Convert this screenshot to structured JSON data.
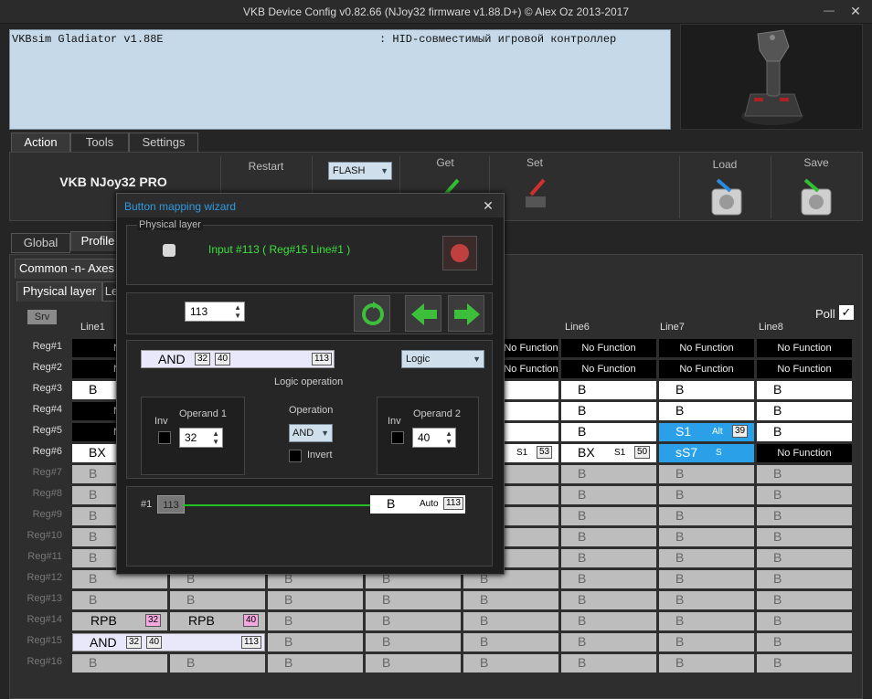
{
  "window": {
    "title": "VKB Device Config v0.82.66 (NJoy32 firmware v1.88.D+) © Alex Oz 2013-2017",
    "minimize": "—",
    "close": "✕"
  },
  "info": {
    "device": "VKBsim Gladiator  v1.88E",
    "desc": ": HID-совместимый игровой контроллер"
  },
  "main_tabs": [
    "Action",
    "Tools",
    "Settings"
  ],
  "toolbar": {
    "device_label": "VKB NJoy32 PRO",
    "restart": "Restart",
    "flash": "FLASH",
    "get": "Get",
    "set": "Set",
    "load": "Load",
    "save": "Save"
  },
  "sub_tabs": [
    "Global",
    "Profile"
  ],
  "subsub_tab": "Common -n- Axes",
  "layer_tabs": [
    "Physical layer",
    "Le"
  ],
  "srv": "Srv",
  "poll": {
    "label": "Poll",
    "check": "✓"
  },
  "columns": [
    "Line1",
    "Line6",
    "Line7",
    "Line8"
  ],
  "rows": [
    "Reg#1",
    "Reg#2",
    "Reg#3",
    "Reg#4",
    "Reg#5",
    "Reg#6",
    "Reg#7",
    "Reg#8",
    "Reg#9",
    "Reg#10",
    "Reg#11",
    "Reg#12",
    "Reg#13",
    "Reg#14",
    "Reg#15",
    "Reg#16"
  ],
  "cells": {
    "nf": "No Function",
    "nf_short": "No",
    "b": "B",
    "bx": "BX",
    "s1": "S1",
    "alt": "Alt",
    "n39": "39",
    "n53": "53",
    "n50": "50",
    "ss7": "sS7",
    "s": "S",
    "rpb": "RPB",
    "n32": "32",
    "n40": "40",
    "and": "AND",
    "n113": "113"
  },
  "dialog": {
    "title": "Button mapping wizard",
    "close": "✕",
    "physical_layer": "Physical layer",
    "input_text": "Input #113 ( Reg#15  Line#1 )",
    "spin_value": "113",
    "logic_expr": {
      "op": "AND",
      "a": "32",
      "b": "40",
      "num": "113"
    },
    "logic_select": "Logic",
    "logic_caption": "Logic operation",
    "inv": "Inv",
    "operand1": "Operand 1",
    "operand1_value": "32",
    "operation": "Operation",
    "operation_value": "AND",
    "invert": "Invert",
    "operand2": "Operand 2",
    "operand2_value": "40",
    "map_idx": "#1",
    "map_num": "113",
    "map_cell": "B",
    "map_auto": "Auto",
    "map_cell_num": "113"
  }
}
